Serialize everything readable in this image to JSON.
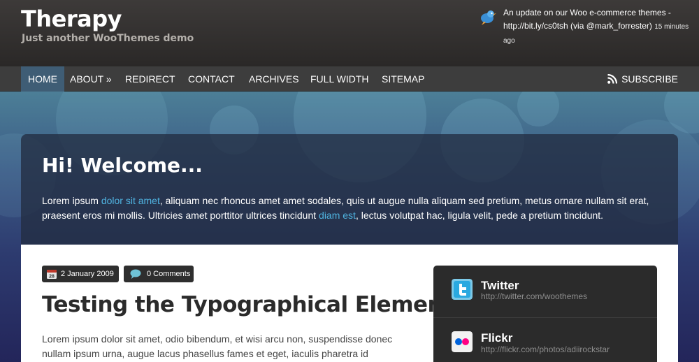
{
  "site": {
    "title": "Therapy",
    "tagline": "Just another WooThemes demo"
  },
  "tweet": {
    "text": "An update on our Woo e-commerce themes - http://bit.ly/cs0tsh (via @mark_forrester)",
    "time": "15 minutes ago"
  },
  "nav": {
    "items": [
      "HOME",
      "ABOUT »",
      "REDIRECT",
      "CONTACT",
      "ARCHIVES",
      "FULL WIDTH",
      "SITEMAP"
    ],
    "active": "HOME",
    "subscribe": "SUBSCRIBE"
  },
  "welcome": {
    "heading": "Hi! Welcome...",
    "text_1": "Lorem ipsum ",
    "link_1": "dolor sit amet",
    "text_2": ", aliquam nec rhoncus amet amet sodales, quis ut augue nulla aliquam sed pretium, metus ornare nullam sit erat, praesent eros mi mollis. Ultricies amet porttitor ultrices tincidunt ",
    "link_2": "diam est",
    "text_3": ", lectus volutpat hac, ligula velit, pede a pretium tincidunt."
  },
  "post": {
    "date": "2 January 2009",
    "calendar_day": "28",
    "comments": "0 Comments",
    "title": "Testing the Typographical Elements",
    "body": "Lorem ipsum dolor sit amet, odio bibendum, et wisi arcu non, suspendisse donec nullam ipsum urna, augue lacus phasellus fames et eget, iaculis pharetra id"
  },
  "sidebar": {
    "twitter": {
      "name": "Twitter",
      "url": "http://twitter.com/woothemes"
    },
    "flickr": {
      "name": "Flickr",
      "url": "http://flickr.com/photos/adiirockstar"
    }
  },
  "colors": {
    "link": "#4fb3e0",
    "nav_active": "#3f5d75",
    "flickr_pink": "#ff0084",
    "flickr_blue": "#0063dc"
  }
}
